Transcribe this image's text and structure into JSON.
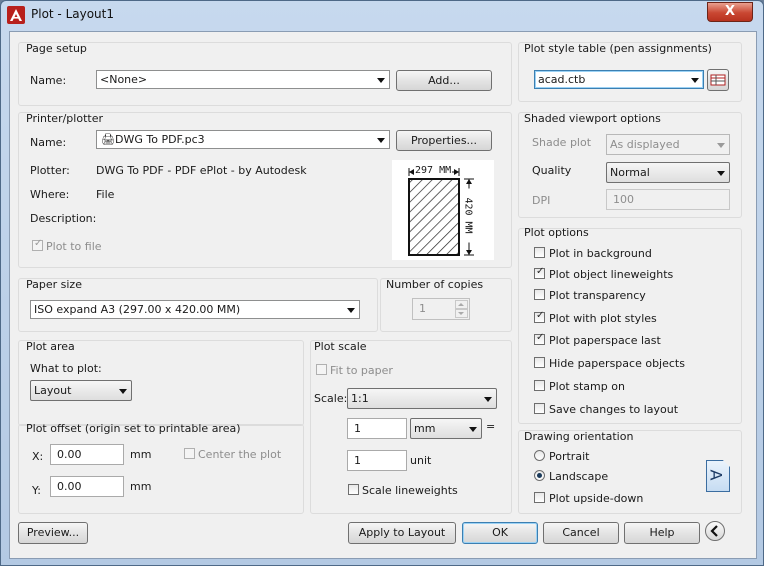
{
  "window": {
    "title": "Plot - Layout1",
    "close_label": "X"
  },
  "page_setup": {
    "group_title": "Page setup",
    "name_label": "Name:",
    "name_value": "<None>",
    "add_button": "Add..."
  },
  "printer": {
    "group_title": "Printer/plotter",
    "name_label": "Name:",
    "name_value": "DWG To PDF.pc3",
    "properties_button": "Properties...",
    "plotter_label": "Plotter:",
    "plotter_value": "DWG To PDF - PDF ePlot - by Autodesk",
    "where_label": "Where:",
    "where_value": "File",
    "description_label": "Description:",
    "plot_to_file_label": "Plot to file",
    "plot_to_file_checked": true,
    "preview_width": "297 MM",
    "preview_height": "420 MM"
  },
  "paper_size": {
    "group_title": "Paper size",
    "value": "ISO expand A3 (297.00 x 420.00 MM)"
  },
  "copies": {
    "group_title": "Number of copies",
    "value": "1"
  },
  "plot_area": {
    "group_title": "Plot area",
    "what_label": "What to plot:",
    "what_value": "Layout"
  },
  "plot_offset": {
    "group_title": "Plot offset (origin set to printable area)",
    "x_label": "X:",
    "x_value": "0.00",
    "x_unit": "mm",
    "y_label": "Y:",
    "y_value": "0.00",
    "y_unit": "mm",
    "center_label": "Center the plot",
    "center_checked": false
  },
  "plot_scale": {
    "group_title": "Plot scale",
    "fit_label": "Fit to paper",
    "fit_checked": false,
    "scale_label": "Scale:",
    "scale_value": "1:1",
    "value1": "1",
    "unit1": "mm",
    "equals": "=",
    "value2": "1",
    "unit2": "unit",
    "lineweights_label": "Scale lineweights",
    "lineweights_checked": false
  },
  "pen_table": {
    "group_title": "Plot style table (pen assignments)",
    "value": "acad.ctb"
  },
  "shaded": {
    "group_title": "Shaded viewport options",
    "shade_label": "Shade plot",
    "shade_value": "As displayed",
    "quality_label": "Quality",
    "quality_value": "Normal",
    "dpi_label": "DPI",
    "dpi_value": "100"
  },
  "plot_options": {
    "group_title": "Plot options",
    "items": [
      {
        "label": "Plot in background",
        "checked": false
      },
      {
        "label": "Plot object lineweights",
        "checked": true
      },
      {
        "label": "Plot transparency",
        "checked": false
      },
      {
        "label": "Plot with plot styles",
        "checked": true
      },
      {
        "label": "Plot paperspace last",
        "checked": true
      },
      {
        "label": "Hide paperspace objects",
        "checked": false
      },
      {
        "label": "Plot stamp on",
        "checked": false
      },
      {
        "label": "Save changes to layout",
        "checked": false
      }
    ]
  },
  "orientation": {
    "group_title": "Drawing orientation",
    "portrait_label": "Portrait",
    "landscape_label": "Landscape",
    "selected": "Landscape",
    "upside_label": "Plot upside-down",
    "upside_checked": false,
    "icon_letter": "A"
  },
  "footer": {
    "preview_button": "Preview...",
    "apply_button": "Apply to Layout",
    "ok_button": "OK",
    "cancel_button": "Cancel",
    "help_button": "Help"
  }
}
